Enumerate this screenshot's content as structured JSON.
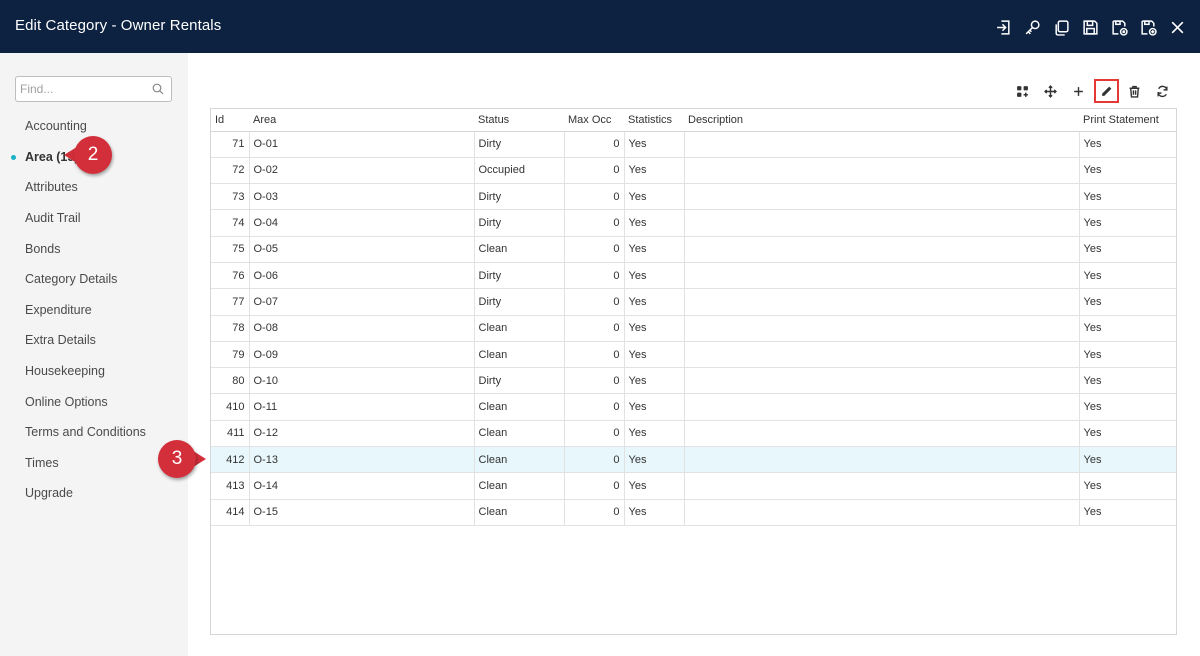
{
  "window": {
    "title": "Edit Category - Owner Rentals",
    "icons": [
      "sign-in-icon",
      "key-icon",
      "copy-icon",
      "save-icon",
      "save-exit-icon",
      "save-close-icon",
      "close-icon"
    ]
  },
  "sidebar": {
    "search_placeholder": "Find...",
    "items": [
      {
        "label": "Accounting",
        "active": false
      },
      {
        "label": "Area (15)",
        "active": true
      },
      {
        "label": "Attributes",
        "active": false
      },
      {
        "label": "Audit Trail",
        "active": false
      },
      {
        "label": "Bonds",
        "active": false
      },
      {
        "label": "Category Details",
        "active": false
      },
      {
        "label": "Expenditure",
        "active": false
      },
      {
        "label": "Extra Details",
        "active": false
      },
      {
        "label": "Housekeeping",
        "active": false
      },
      {
        "label": "Online Options",
        "active": false
      },
      {
        "label": "Terms and Conditions",
        "active": false
      },
      {
        "label": "Times",
        "active": false
      },
      {
        "label": "Upgrade",
        "active": false
      }
    ]
  },
  "toolbar": {
    "buttons": [
      "grid-options-icon",
      "move-icon",
      "add-icon",
      "edit-icon",
      "delete-icon",
      "refresh-icon"
    ],
    "highlighted": "edit-icon"
  },
  "grid": {
    "columns": [
      "Id",
      "Area",
      "Status",
      "Max Occ",
      "Statistics",
      "Description",
      "Print Statement"
    ],
    "rows": [
      {
        "id": "71",
        "area": "O-01",
        "status": "Dirty",
        "max_occ": "0",
        "statistics": "Yes",
        "description": "",
        "print_statement": "Yes"
      },
      {
        "id": "72",
        "area": "O-02",
        "status": "Occupied",
        "max_occ": "0",
        "statistics": "Yes",
        "description": "",
        "print_statement": "Yes"
      },
      {
        "id": "73",
        "area": "O-03",
        "status": "Dirty",
        "max_occ": "0",
        "statistics": "Yes",
        "description": "",
        "print_statement": "Yes"
      },
      {
        "id": "74",
        "area": "O-04",
        "status": "Dirty",
        "max_occ": "0",
        "statistics": "Yes",
        "description": "",
        "print_statement": "Yes"
      },
      {
        "id": "75",
        "area": "O-05",
        "status": "Clean",
        "max_occ": "0",
        "statistics": "Yes",
        "description": "",
        "print_statement": "Yes"
      },
      {
        "id": "76",
        "area": "O-06",
        "status": "Dirty",
        "max_occ": "0",
        "statistics": "Yes",
        "description": "",
        "print_statement": "Yes"
      },
      {
        "id": "77",
        "area": "O-07",
        "status": "Dirty",
        "max_occ": "0",
        "statistics": "Yes",
        "description": "",
        "print_statement": "Yes"
      },
      {
        "id": "78",
        "area": "O-08",
        "status": "Clean",
        "max_occ": "0",
        "statistics": "Yes",
        "description": "",
        "print_statement": "Yes"
      },
      {
        "id": "79",
        "area": "O-09",
        "status": "Clean",
        "max_occ": "0",
        "statistics": "Yes",
        "description": "",
        "print_statement": "Yes"
      },
      {
        "id": "80",
        "area": "O-10",
        "status": "Dirty",
        "max_occ": "0",
        "statistics": "Yes",
        "description": "",
        "print_statement": "Yes"
      },
      {
        "id": "410",
        "area": "O-11",
        "status": "Clean",
        "max_occ": "0",
        "statistics": "Yes",
        "description": "",
        "print_statement": "Yes"
      },
      {
        "id": "411",
        "area": "O-12",
        "status": "Clean",
        "max_occ": "0",
        "statistics": "Yes",
        "description": "",
        "print_statement": "Yes"
      },
      {
        "id": "412",
        "area": "O-13",
        "status": "Clean",
        "max_occ": "0",
        "statistics": "Yes",
        "description": "",
        "print_statement": "Yes",
        "selected": true
      },
      {
        "id": "413",
        "area": "O-14",
        "status": "Clean",
        "max_occ": "0",
        "statistics": "Yes",
        "description": "",
        "print_statement": "Yes"
      },
      {
        "id": "414",
        "area": "O-15",
        "status": "Clean",
        "max_occ": "0",
        "statistics": "Yes",
        "description": "",
        "print_statement": "Yes"
      }
    ]
  },
  "callouts": [
    {
      "label": "2",
      "target": "Area (15)"
    },
    {
      "label": "3",
      "target": "row 412"
    }
  ],
  "colors": {
    "titlebar": "#0d2240",
    "accent_dot": "#1ab1c7",
    "callout": "#d32f3a",
    "highlight_border": "#e53935",
    "selected_row": "#e8f7fb"
  }
}
